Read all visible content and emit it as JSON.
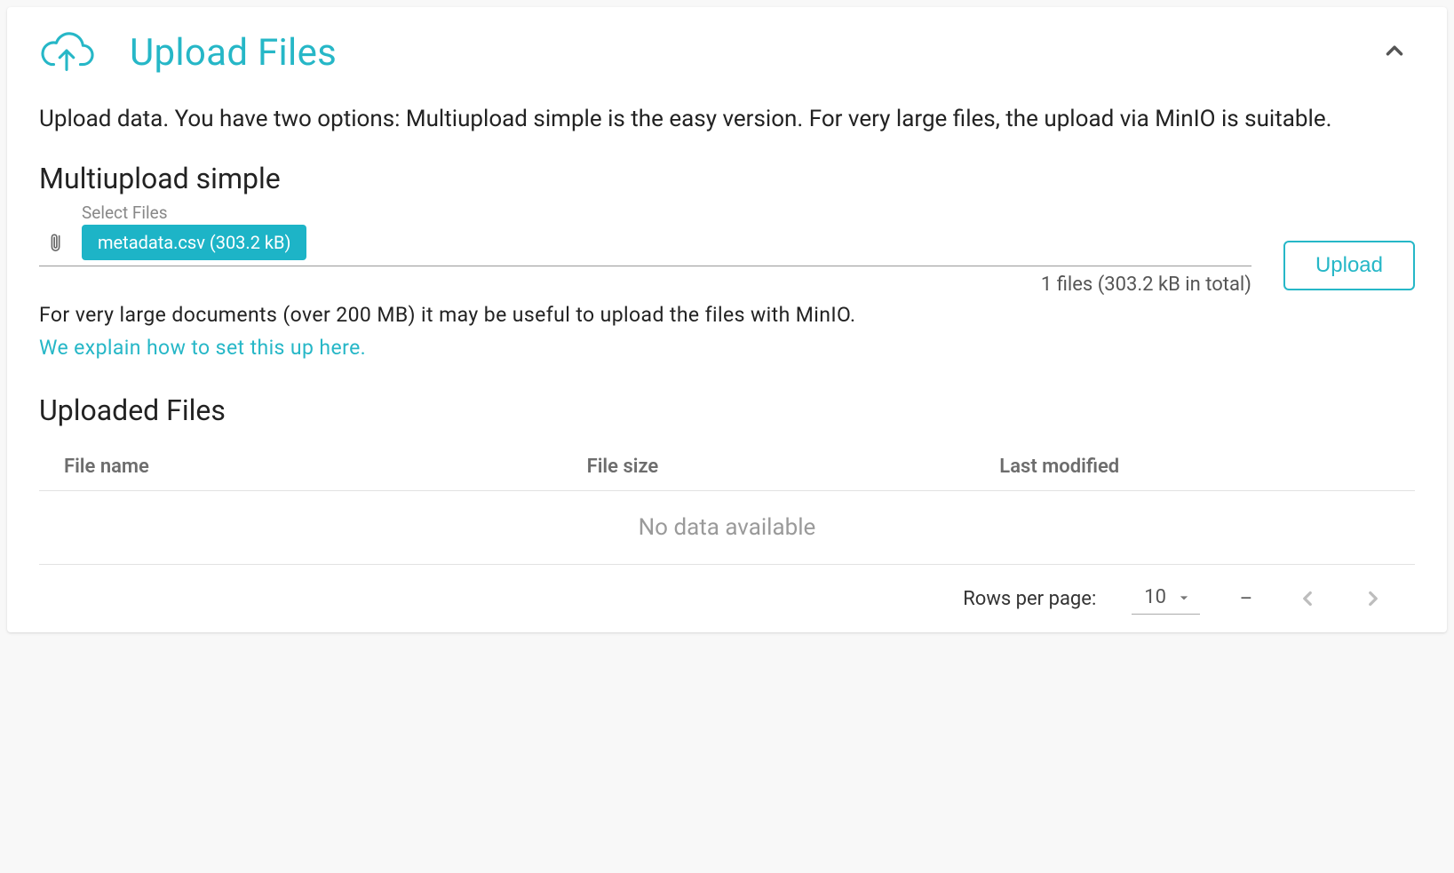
{
  "header": {
    "title": "Upload Files"
  },
  "description": "Upload data. You have two options: Multiupload simple is the easy version. For very large files, the upload via MinIO is suitable.",
  "multiupload": {
    "heading": "Multiupload simple",
    "select_label": "Select Files",
    "selected_chip": "metadata.csv (303.2 kB)",
    "summary": "1 files (303.2 kB in total)",
    "upload_button": "Upload"
  },
  "minio": {
    "note": "For very large documents (over 200 MB) it may be useful to upload the files with MinIO.",
    "link": "We explain how to set this up here."
  },
  "uploaded": {
    "heading": "Uploaded Files",
    "columns": {
      "name": "File name",
      "size": "File size",
      "modified": "Last modified"
    },
    "empty_text": "No data available"
  },
  "pagination": {
    "rows_label": "Rows per page:",
    "rows_value": "10",
    "range": "–"
  }
}
